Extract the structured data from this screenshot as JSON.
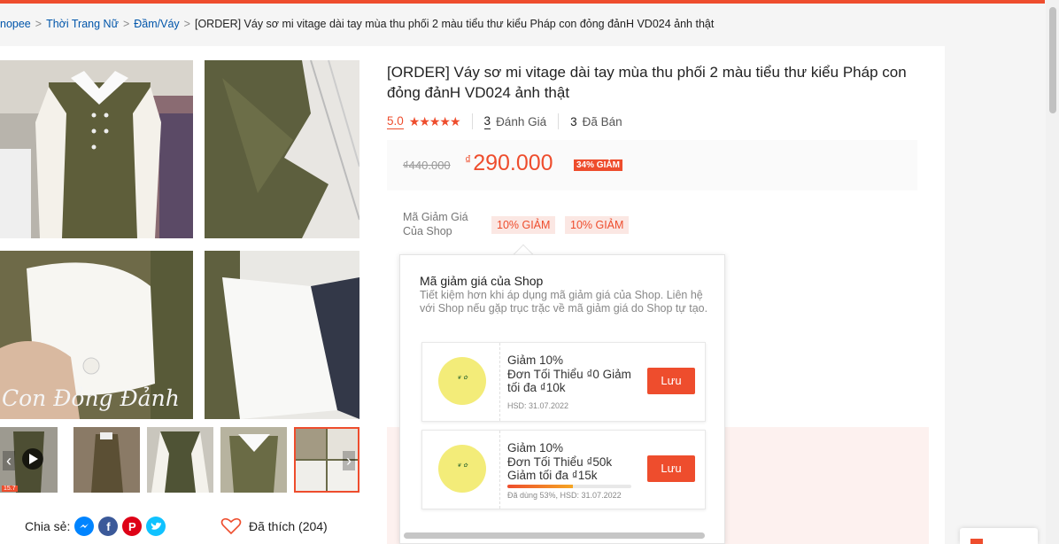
{
  "breadcrumb": {
    "items": [
      "nopee",
      "Thời Trang Nữ",
      "Đầm/Váy"
    ],
    "current": "[ORDER] Váy sơ mi vitage dài tay mùa thu phối 2 màu tiểu thư kiểu Pháp con đỏng đảnH VD024 ảnh thật",
    "separator": ">"
  },
  "gallery": {
    "watermark": "Con Đỏng Đảnh",
    "badge": "15.7",
    "thumbs": 5,
    "prev_icon": "chevron-left-icon",
    "next_icon": "chevron-right-icon"
  },
  "product": {
    "title": "[ORDER] Váy sơ mi vitage dài tay mùa thu phối 2 màu tiểu thư kiểu Pháp con đỏng đảnH VD024 ảnh thật",
    "rating": "5.0",
    "rating_value": 5,
    "reviews_count": "3",
    "reviews_label": "Đánh Giá",
    "sold_count": "3",
    "sold_label": "Đã Bán",
    "old_price": "₫440.000",
    "currency": "₫",
    "new_price": "290.000",
    "discount_badge": "34% GIẢM"
  },
  "vouchers": {
    "label": "Mã Giảm Giá Của Shop",
    "tags": [
      "10% GIẢM",
      "10% GIẢM"
    ]
  },
  "popup": {
    "title": "Mã giảm giá của Shop",
    "description": "Tiết kiệm hơn khi áp dụng mã giảm giá của Shop. Liên hệ với Shop nếu gặp trục trặc về mã giảm giá do Shop tự tạo.",
    "cards": [
      {
        "title": "Giảm 10%",
        "condition": "Đơn Tối Thiểu ₫0 Giảm tối đa ₫10k",
        "expiry": "HSD: 31.07.2022",
        "button": "Lưu",
        "used_percent": null
      },
      {
        "title": "Giảm 10%",
        "condition": "Đơn Tối Thiểu ₫50k Giảm tối đa ₫15k",
        "expiry": "Đã dùng 53%, HSD: 31.07.2022",
        "button": "Lưu",
        "used_percent": 53
      }
    ]
  },
  "share": {
    "label": "Chia sẻ:",
    "icons": [
      "messenger-icon",
      "facebook-icon",
      "pinterest-icon",
      "twitter-icon"
    ],
    "liked": "Đã thích (204)"
  },
  "colors": {
    "accent": "#ee4d2d",
    "link": "#0055aa",
    "messenger": "#0084ff",
    "facebook": "#3b5999",
    "pinterest": "#de0217",
    "twitter": "#10c2ff"
  }
}
